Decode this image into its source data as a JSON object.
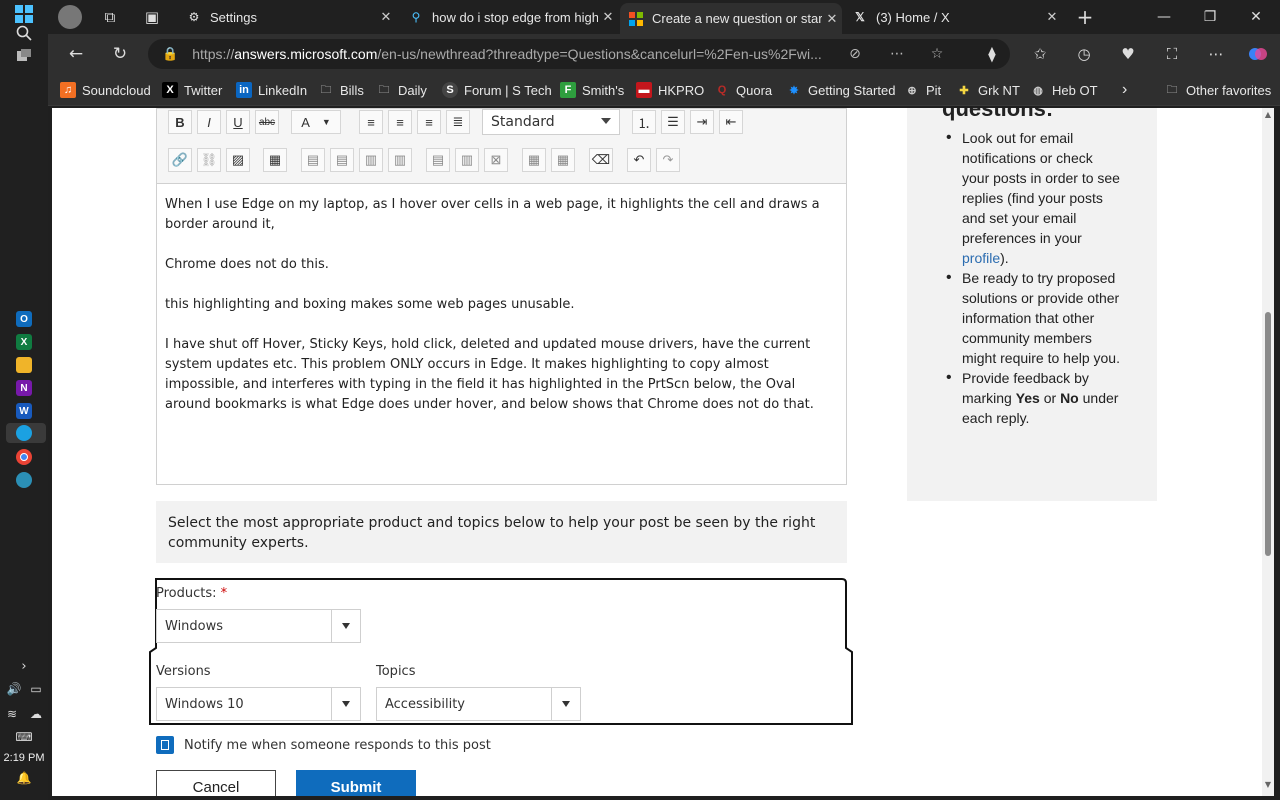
{
  "taskbar": {
    "time": "2:19 PM"
  },
  "tabs": [
    {
      "title": "Settings",
      "icon": "gear-icon"
    },
    {
      "title": "how do i stop edge from high",
      "icon": "search-icon"
    },
    {
      "title": "Create a new question or start",
      "icon": "microsoft-logo-icon"
    },
    {
      "title": "(3) Home / X",
      "icon": "x-logo-icon"
    }
  ],
  "address": {
    "url_domain": "answers.microsoft.com",
    "url_prefix": "https://",
    "url_rest": "/en-us/newthread?threadtype=Questions&cancelurl=%2Fen-us%2Fwi..."
  },
  "favorites": [
    {
      "label": "Soundcloud",
      "color": "#f26f23"
    },
    {
      "label": "Twitter",
      "color": "#000000"
    },
    {
      "label": "LinkedIn",
      "color": "#0a66c2"
    },
    {
      "label": "Bills",
      "color": ""
    },
    {
      "label": "Daily",
      "color": ""
    },
    {
      "label": "Forum | S Tech",
      "color": "#444444"
    },
    {
      "label": "Smith's",
      "color": "#2e9e3e"
    },
    {
      "label": "HKPRO",
      "color": "#c4161c"
    },
    {
      "label": "Quora",
      "color": "#b92b27"
    },
    {
      "label": "Getting Started",
      "color": "#1e90ff"
    },
    {
      "label": "Pit",
      "color": "#444444"
    },
    {
      "label": "Grk NT",
      "color": "#222222"
    },
    {
      "label": "Heb OT",
      "color": "#555555"
    }
  ],
  "favorites_other": "Other favorites",
  "editor": {
    "style_value": "Standard",
    "paragraphs": [
      "When I use Edge on my laptop, as I hover over cells in a web page, it highlights the cell and draws a border around it,",
      "Chrome does not do this.",
      "this highlighting and boxing makes some web pages unusable.",
      "I have shut off Hover, Sticky Keys, hold click, deleted and updated mouse drivers, have the current system updates etc.  This problem ONLY occurs in Edge.  It makes highlighting to copy almost impossible, and interferes with typing in the field it has highlighted  in the PrtScn below, the Oval around bookmarks is what Edge does under hover, and below shows that Chrome does not do that."
    ]
  },
  "side": {
    "heading": "questions:",
    "item1_text": "Look out for email notifications or check your posts in order to see replies (find your posts and set your email preferences in your ",
    "item1_link": "profile",
    "item1_end": ").",
    "item2": "Be ready to try proposed solutions or provide other information that other community members might require to help you.",
    "item3_a": "Provide feedback by marking ",
    "item3_yes": "Yes",
    "item3_or": " or ",
    "item3_no": "No",
    "item3_end": " under each reply."
  },
  "info_text": "Select the most appropriate product and topics below to help your post be seen by the right community experts.",
  "form": {
    "products_label": "Products:",
    "required_mark": "*",
    "products_value": "Windows",
    "versions_label": "Versions",
    "versions_value": "Windows 10",
    "topics_label": "Topics",
    "topics_value": "Accessibility",
    "notify_label": "Notify me when someone responds to this post",
    "cancel_label": "Cancel",
    "submit_label": "Submit"
  },
  "colors": {
    "accent": "#0f6cbd",
    "link": "#2b6cb0",
    "required": "#cc0000"
  }
}
